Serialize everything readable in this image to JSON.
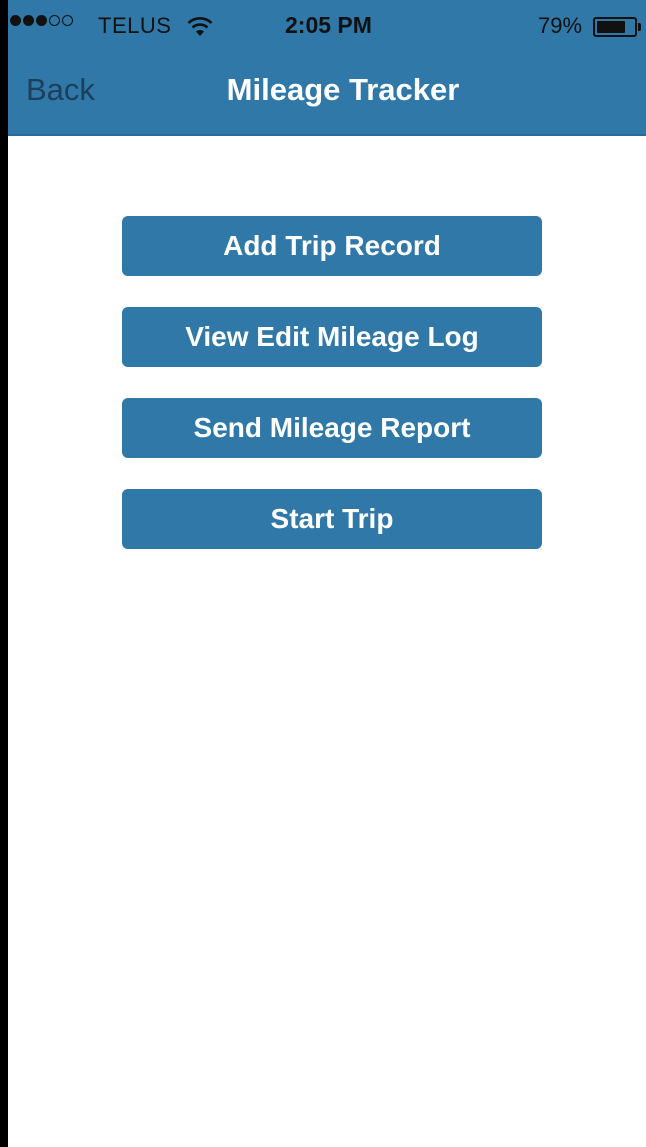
{
  "status_bar": {
    "signal_dots_filled": 3,
    "signal_dots_total": 5,
    "carrier": "TELUS",
    "time": "2:05 PM",
    "battery_percent": "79%",
    "battery_level": 0.79,
    "wifi_icon": "wifi-icon"
  },
  "nav": {
    "back_label": "Back",
    "title": "Mileage Tracker"
  },
  "menu": {
    "items": [
      {
        "label": "Add Trip Record"
      },
      {
        "label": "View Edit Mileage Log"
      },
      {
        "label": "Send Mileage Report"
      },
      {
        "label": "Start Trip"
      }
    ]
  },
  "colors": {
    "accent": "#2f78a8",
    "button_text": "#ffffff",
    "back_text": "#1c3f5a"
  }
}
